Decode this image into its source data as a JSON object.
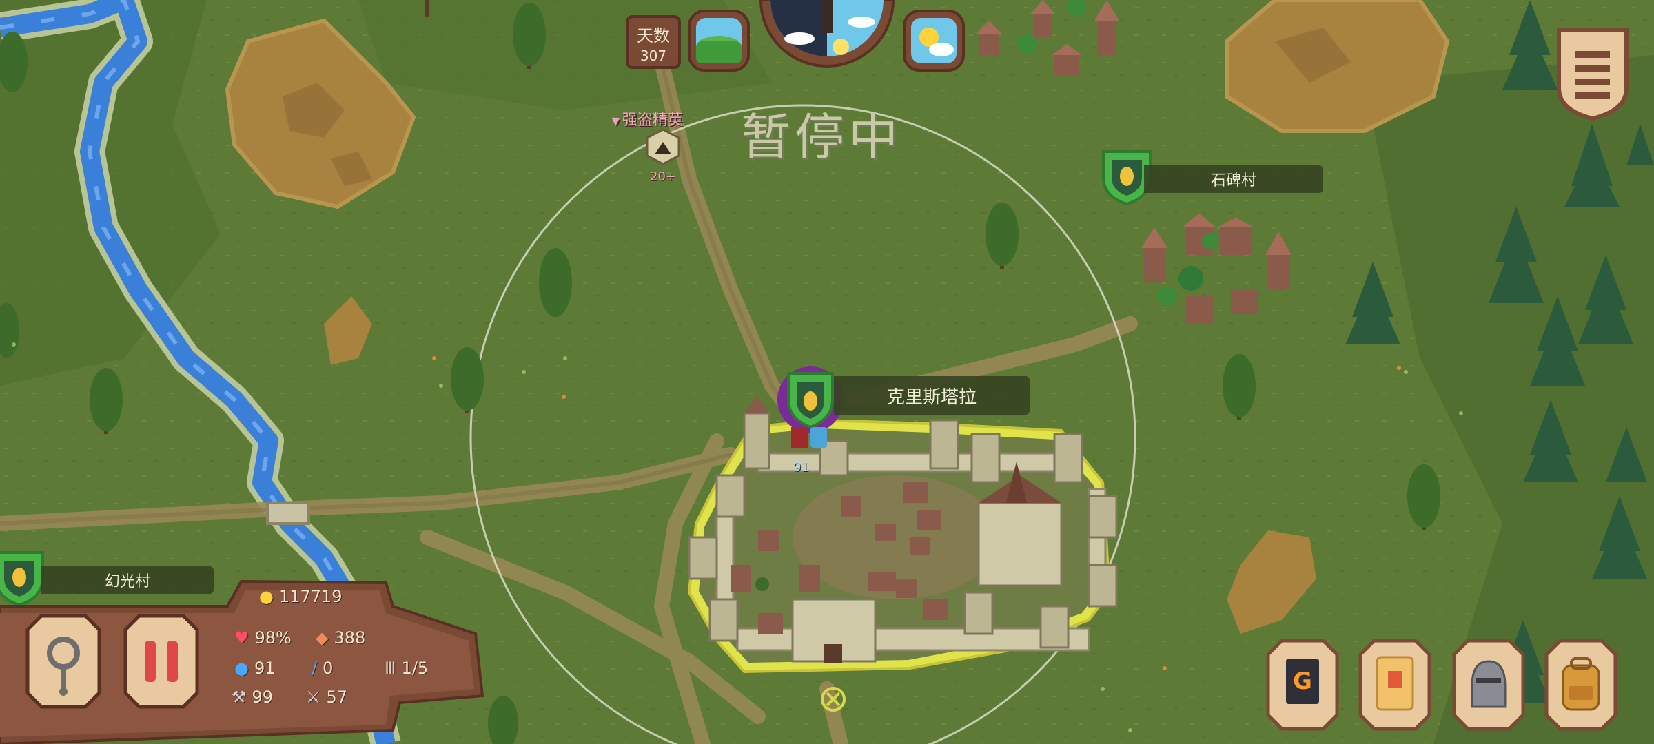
{
  "top_bar": {
    "day_label": "天数",
    "day_value": "307",
    "weather_left": "grass-weather-icon",
    "weather_right": "sunny-cloud-icon"
  },
  "status": {
    "paused_text": "暂停中"
  },
  "enemy": {
    "name": "强盗精英",
    "level": "20+"
  },
  "villages": {
    "stele_village": "石碑村",
    "castle": "克里斯塔拉",
    "phantom_village": "幻光村"
  },
  "army": {
    "count": "91"
  },
  "resources": {
    "gold": "117719",
    "health": "98%",
    "food": "388",
    "population": "91",
    "soldiers": "0",
    "ranks": "1/5",
    "tools": "99",
    "weapons": "57"
  },
  "icons": {
    "gold": "coin-icon",
    "health": "heart-icon",
    "food": "meat-icon",
    "population": "person-icon",
    "soldiers": "sword-icon",
    "ranks": "rank-icon",
    "tools": "hammer-icon",
    "weapons": "weapon-icon",
    "menu": "menu-icon",
    "magnify": "magnifier-icon",
    "pause": "pause-icon",
    "codex": "codex-book-icon",
    "quest": "quest-scroll-icon",
    "hero": "knight-helmet-icon",
    "bag": "backpack-icon"
  },
  "colors": {
    "grass": "#5d7a37",
    "river": "#3a7fd8",
    "dirt": "#a8823f",
    "panel_wood": "#7a4a35",
    "kingdom_border": "#e0e44a",
    "player_purple": "#7b2a9a"
  }
}
